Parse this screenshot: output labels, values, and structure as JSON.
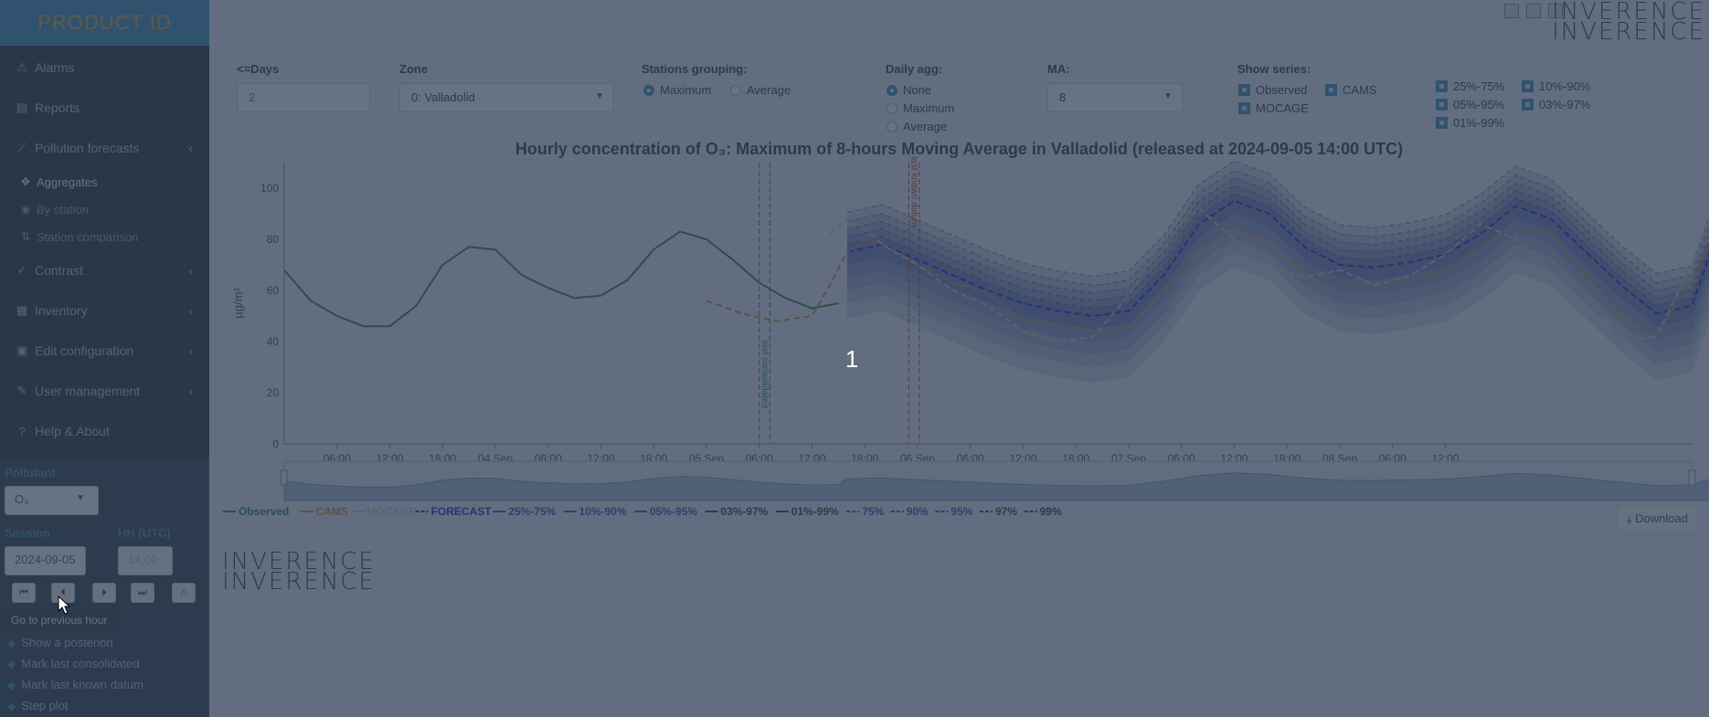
{
  "app": {
    "logo_text": "PRODUCT ID",
    "brand": "INVERENCE"
  },
  "sidebar": {
    "items": [
      {
        "label": "Alarms",
        "icon": "warning-icon"
      },
      {
        "label": "Reports",
        "icon": "book-icon"
      },
      {
        "label": "Pollution forecasts",
        "icon": "line-chart-icon"
      },
      {
        "label": "Aggregates",
        "icon": "expand-icon"
      },
      {
        "label": "By station",
        "icon": "compass-icon"
      },
      {
        "label": "Station comparison",
        "icon": "exchange-icon"
      },
      {
        "label": "Contrast",
        "icon": "check-icon"
      },
      {
        "label": "Inventory",
        "icon": "inventory-icon"
      },
      {
        "label": "Edit configuration",
        "icon": "calendar-icon"
      },
      {
        "label": "User management",
        "icon": "edit-icon"
      },
      {
        "label": "Help & About",
        "icon": "question-icon"
      }
    ]
  },
  "controls": {
    "pollutant_label": "Pollutant",
    "pollutant_value": "O₃",
    "session_label": "Session",
    "session_value": "2024-09-05",
    "hh_label": "HH (UTC)",
    "hh_value": "14:00",
    "tooltip": "Go to previous hour",
    "options": [
      "Show a posteriori",
      "Mark last consolidated",
      "Mark last known datum",
      "Step plot"
    ]
  },
  "filters": {
    "days_label": "<=Days",
    "days_value": "2",
    "zone_label": "Zone",
    "zone_value": "0: Valladolid",
    "grouping_label": "Stations grouping:",
    "grouping_options": [
      "Maximum",
      "Average"
    ],
    "daily_label": "Daily agg:",
    "daily_options": [
      "None",
      "Maximum",
      "Average"
    ],
    "ma_label": "MA:",
    "ma_value": "8",
    "series_label": "Show series:",
    "series_a": [
      "Observed",
      "CAMS",
      "MOCAGE"
    ],
    "series_b": [
      "25%-75%",
      "10%-90%",
      "05%-95%",
      "03%-97%",
      "01%-99%"
    ]
  },
  "chart_data": {
    "type": "line",
    "title": "Hourly concentration of O₃: Maximum of 8-hours Moving Average in Valladolid (released at 2024-09-05 14:00 UTC)",
    "ylabel": "µg/m³",
    "ylim": [
      0,
      110
    ],
    "y_ticks": [
      0,
      20,
      40,
      60,
      80,
      100
    ],
    "x_ticks": [
      "06:00",
      "12:00",
      "18:00",
      "04 Sep",
      "06:00",
      "12:00",
      "18:00",
      "05 Sep",
      "06:00",
      "12:00",
      "18:00",
      "06 Sep",
      "06:00",
      "12:00",
      "18:00",
      "07 Sep",
      "06:00",
      "12:00",
      "18:00",
      "08 Sep",
      "06:00",
      "12:00"
    ],
    "x_start": "2024-09-03 00:00",
    "markers": [
      "last consolidated",
      "last known datum"
    ],
    "series": [
      {
        "name": "Observed",
        "color": "#2e7d32",
        "hours": [
          0,
          3,
          6,
          9,
          12,
          15,
          18,
          21,
          24,
          27,
          30,
          33,
          36,
          39,
          42,
          45,
          48,
          51,
          54,
          57,
          60,
          63
        ],
        "values": [
          68,
          56,
          50,
          46,
          46,
          54,
          70,
          77,
          76,
          66,
          61,
          57,
          58,
          64,
          76,
          83,
          80,
          72,
          63,
          57,
          53,
          55
        ]
      },
      {
        "name": "Forecast",
        "color": "#1a1fbf",
        "hours": [
          64,
          68,
          72,
          76,
          80,
          84,
          88,
          92,
          96,
          100,
          104,
          108,
          112,
          116,
          120,
          124,
          128,
          132,
          136,
          140,
          144,
          148,
          152,
          156,
          160,
          163
        ],
        "values": [
          75,
          78,
          72,
          66,
          60,
          55,
          52,
          50,
          52,
          66,
          86,
          95,
          90,
          77,
          70,
          69,
          71,
          74,
          82,
          93,
          88,
          75,
          62,
          51,
          54,
          83
        ]
      },
      {
        "name": "CAMS",
        "color": "#d9882e",
        "hours": [
          48,
          52,
          56,
          60,
          62,
          64,
          66,
          68,
          72,
          76,
          80,
          84,
          88,
          92,
          96,
          100,
          104,
          108,
          112,
          116,
          120,
          124,
          128,
          132,
          136,
          140,
          144,
          148,
          152,
          156,
          160,
          163
        ],
        "values": [
          56,
          51,
          48,
          50,
          62,
          75,
          80,
          78,
          70,
          63,
          59,
          48,
          47,
          44,
          45,
          60,
          76,
          85,
          78,
          66,
          63,
          62,
          64,
          67,
          78,
          84,
          82,
          66,
          50,
          42,
          64,
          84
        ]
      },
      {
        "name": "MOCAGE",
        "color": "#c7c7c7",
        "hours": [
          62,
          64,
          66,
          68,
          72,
          76,
          80,
          84,
          88,
          92,
          96,
          100,
          104,
          108,
          112,
          116,
          120,
          124,
          128,
          132,
          136,
          140,
          144,
          148,
          152,
          156,
          160,
          163
        ],
        "values": [
          82,
          88,
          84,
          78,
          70,
          60,
          54,
          44,
          40,
          42,
          58,
          80,
          92,
          80,
          70,
          65,
          68,
          62,
          66,
          74,
          86,
          80,
          68,
          60,
          40,
          42,
          70,
          86
        ]
      }
    ],
    "legend": [
      "Observed",
      "CAMS",
      "MOCAGE",
      "FORECAST",
      "25%-75%",
      "10%-90%",
      "05%-95%",
      "03%-97%",
      "01%-99%",
      "75%",
      "90%",
      "95%",
      "97%",
      "99%"
    ]
  },
  "main": {
    "download_label": "Download",
    "step_number": "1"
  }
}
